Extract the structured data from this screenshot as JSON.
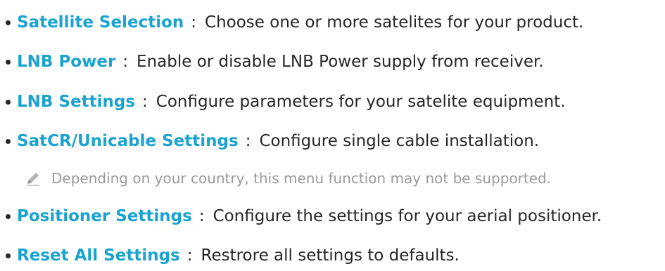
{
  "items": [
    {
      "term": "Satellite Selection",
      "sep": ":",
      "desc": "Choose one or more satelites for your product."
    },
    {
      "term": "LNB Power",
      "sep": ":",
      "desc": "Enable or disable LNB Power supply from receiver."
    },
    {
      "term": "LNB Settings",
      "sep": ":",
      "desc": "Configure parameters for your satelite equipment."
    },
    {
      "term": "SatCR/Unicable Settings",
      "sep": ":",
      "desc": "Configure single cable installation."
    },
    {
      "term": "Positioner Settings",
      "sep": ":",
      "desc": "Configure the settings for your aerial positioner."
    },
    {
      "term": "Reset All Settings",
      "sep": ":",
      "desc": "Restrore all settings to defaults."
    }
  ],
  "note": {
    "icon": "pencil-icon",
    "text": "Depending on your country, this menu function may not be supported."
  },
  "colors": {
    "term": "#1aa3cf",
    "body_text": "#262626",
    "note_text": "#9a9a9a"
  }
}
